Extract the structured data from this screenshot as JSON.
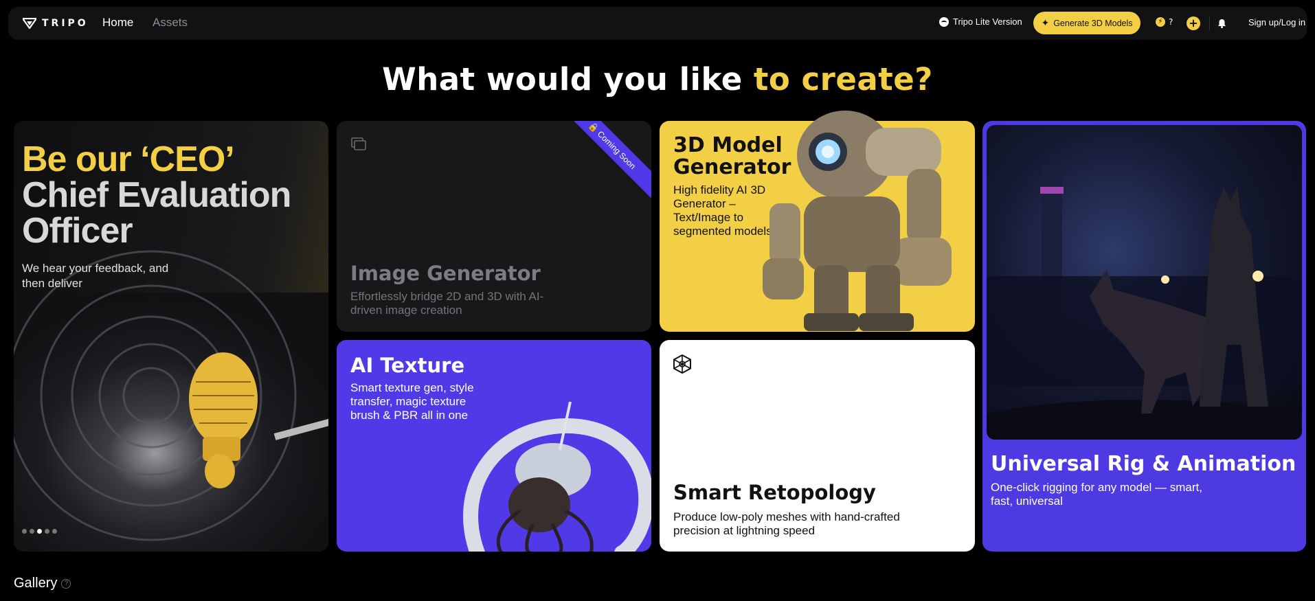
{
  "nav": {
    "brand": "TRIPO",
    "links": [
      "Home",
      "Assets"
    ],
    "lite_label": "Tripo Lite Version",
    "generate_label": "Generate 3D Models",
    "credits": "?",
    "sign_in": "Sign up/Log in"
  },
  "headline": {
    "part1": "What would you like ",
    "part2": "to create?"
  },
  "cards": {
    "ceo": {
      "title_line1": "Be our ‘CEO’",
      "title_line2": "Chief Evaluation",
      "title_line3": "Officer",
      "subtitle": "We hear your feedback, and then deliver",
      "carousel_count": 5,
      "carousel_active": 3
    },
    "image_generator": {
      "badge": "Coming Soon",
      "title": "Image Generator",
      "description": "Effortlessly bridge 2D and 3D with AI-driven image creation"
    },
    "model_generator": {
      "title": "3D Model Generator",
      "description": "High fidelity AI 3D Generator – Text/Image to segmented models"
    },
    "ai_texture": {
      "title": "AI Texture",
      "description": "Smart texture gen, style transfer, magic texture brush & PBR all in one"
    },
    "smart_retopology": {
      "title": "Smart Retopology",
      "description": "Produce low-poly meshes with hand-crafted precision at lightning speed"
    },
    "rig_animation": {
      "title": "Universal Rig & Animation",
      "description": "One-click rigging for any model — smart, fast, universal"
    }
  },
  "gallery": {
    "title": "Gallery"
  },
  "colors": {
    "accent": "#f2cf45",
    "purple": "#5039e6",
    "bg": "#000000",
    "nav_bg": "#121214"
  }
}
